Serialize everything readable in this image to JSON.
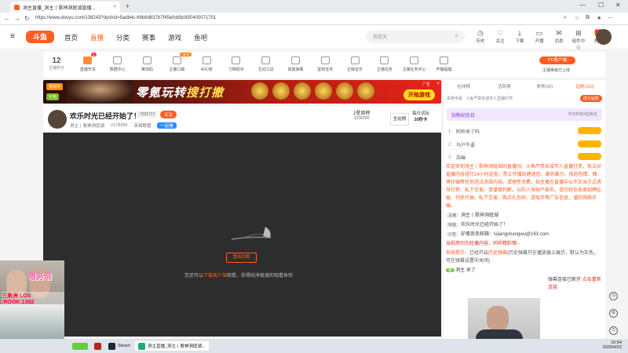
{
  "browser": {
    "tab_title": "洞主直播_洞主丨歌神洞庭湖直播...",
    "close_tab": "×",
    "new_tab": "+",
    "url": "https://www.douyu.com/138243?dyshid=5adb4c-66b6d837b7f45efcbfdc85040007170​1",
    "win_min": "—",
    "win_max": "☐",
    "win_close": "✕",
    "back": "←",
    "forward": "→",
    "reload": "↻"
  },
  "header": {
    "logo": "斗鱼",
    "nav": [
      "首页",
      "直播",
      "分类",
      "赛事",
      "游戏",
      "鱼吧"
    ],
    "search_placeholder": "我愿天",
    "icons": [
      {
        "label": "历史",
        "glyph": "◷"
      },
      {
        "label": "关注",
        "glyph": "♡"
      },
      {
        "label": "下载",
        "glyph": "⤓"
      },
      {
        "label": "开播",
        "glyph": "▭"
      },
      {
        "label": "消息",
        "glyph": "✉"
      },
      {
        "label": "组件中心",
        "glyph": "⊞"
      },
      {
        "label": "充值",
        "glyph": "🎁"
      }
    ]
  },
  "toolbar": {
    "score": "12",
    "score_label": "主播积分",
    "tools": [
      "直播开关",
      "数据中心",
      "推流码",
      "主播口袋",
      "AI礼物",
      "刀锋助手",
      "互动工具",
      "高能弹幕",
      "鉴权任务",
      "正版音乐",
      "主播任务",
      "主播任务中心",
      "开播提醒"
    ],
    "badge": "1",
    "new_badge": "NEW",
    "pc_button": "PC客户端",
    "upgrade": "主播等级已上线"
  },
  "banner": {
    "hot": "预热中",
    "pill2": "可用",
    "title_a": "零氪玩转",
    "title_b": "搜打撤",
    "ad": "广告",
    "cta": "开始游戏",
    "close": "×"
  },
  "room": {
    "title": "欢乐时光已经开始了！",
    "room_id": "7031717",
    "follow": "关注",
    "host": "洞主丨歌神洞庭湖",
    "fans": "2178290",
    "category": "英雄联盟",
    "tag": "一起看",
    "rank_label": "1星周榜",
    "rank_value": "123/200",
    "all_rank": "全站榜",
    "daily_label": "每日试玩",
    "daily_value": "20秒卡"
  },
  "player": {
    "refresh": "重新加载",
    "hint_pre": "您还可以",
    "hint_link": "下载客户端",
    "hint_post": "观看，获得纯净极速的观看体验"
  },
  "rpanel": {
    "tabs": [
      "在线榜",
      "活跃榜",
      "贵宾(20)",
      "钻粉(110)"
    ],
    "noble_tip": "贵族专属",
    "noble_text": "斗鱼严禁未成年人直播打赏",
    "noble_pay": "成为钻粉",
    "fans_title": "钻粉纪念日",
    "fans_date": "今日共有4位粉丝",
    "ranks": [
      {
        "num": "1",
        "name": "阿柃来了吗"
      },
      {
        "num": "2",
        "name": "马户牛逼"
      },
      {
        "num": "3",
        "name": "苏幽"
      }
    ],
    "welcome": "欢迎来到洞主丨歌神洞庭湖的直播间。斗鱼严禁未成年人直播打赏。依法对直播内容进行24小时巡查。禁止传播封建迷信、暴恐暴力、低俗色情、赌博诈骗等任何违法违规内容。请理性消费，如主播在直播中以不正当方式诱导打赏、私下交易，请谨慎判断，以防人身财产损失。请勿轻信各类招聘征婚、代练代抽、私下交易、购买礼包码、游戏币等广告信息，谨防网络诈骗。",
    "lines": [
      {
        "label": "主播",
        "text": "洞主丨歌神洞庭湖"
      },
      {
        "label": "标题",
        "text": "欢乐时光已经开始了！"
      },
      {
        "label": "公告",
        "text": "驴蛋商务邮箱：lvjiangshangwu@163.com"
      }
    ],
    "sys_warn": "当前房间为轮播内容，同样精彩哦~",
    "sys_tip_label": "系统提示：",
    "sys_tip_pre": "已经开启",
    "sys_tip_link": "历史弹幕",
    "sys_tip_post": "(历史弹幕只在播放器上展示，默认为灰色，可在弹幕设置中关闭)",
    "user_join_name": "洞主",
    "user_join_text": "来了",
    "fu_badge": "福",
    "msg_cut": "弹幕连接已断开",
    "msg_cut2": "点击重新连接"
  },
  "sidebtns": [
    "◷",
    "⊕",
    "⊙"
  ],
  "overlay": {
    "name": "嗷务浩",
    "id": "三角洲 LOS :ROOK:1382"
  },
  "taskbar": {
    "items": [
      "Steam",
      "洞主直播_洞主丨歌神洞庭湖..."
    ],
    "time": "16:54",
    "date": "2026/4/22"
  }
}
